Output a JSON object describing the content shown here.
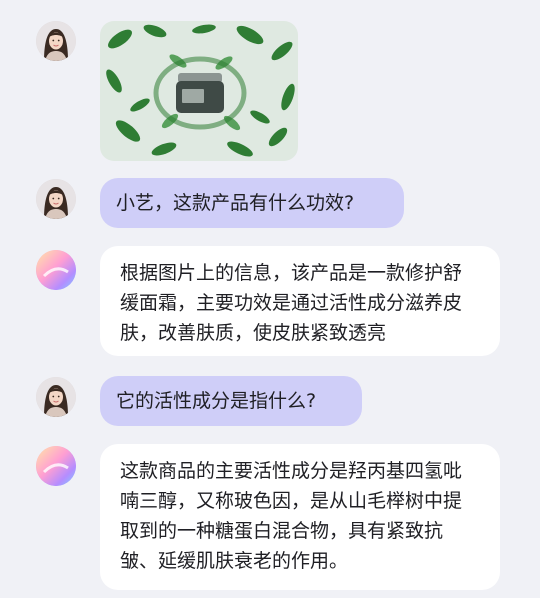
{
  "conversation": {
    "q1": "小艺，这款产品有什么功效?",
    "a1": "根据图片上的信息，该产品是一款修护舒缓面霜，主要功效是通过活性成分滋养皮肤，改善肤质，使皮肤紧致透亮",
    "q2": "它的活性成分是指什么?",
    "a2": "这款商品的主要活性成分是羟丙基四氢吡喃三醇，又称玻色因，是从山毛榉树中提取到的一种糖蛋白混合物，具有紧致抗皱、延缓肌肤衰老的作用。"
  },
  "icons": {
    "user_avatar": "user-avatar",
    "assistant_avatar": "assistant-avatar",
    "product_photo": "skincare-jar-with-leaves"
  },
  "colors": {
    "background": "#f0f1f6",
    "user_bubble": "#cfcef8",
    "assistant_bubble": "#ffffff",
    "text": "#1f1f24"
  }
}
